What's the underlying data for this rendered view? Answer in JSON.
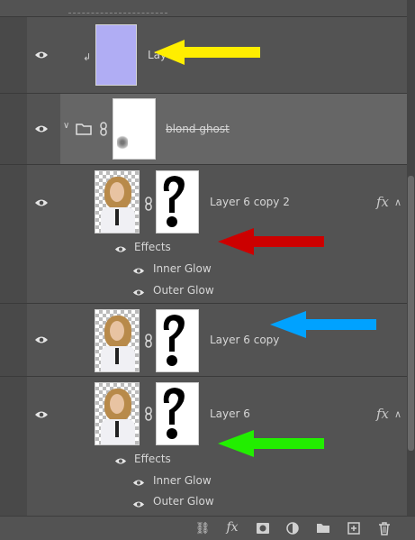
{
  "layers": [
    {
      "name": "Layer 7",
      "type": "fill-clipped"
    },
    {
      "name": "blond ghost",
      "type": "group"
    },
    {
      "name": "Layer 6 copy 2",
      "fx": "fx",
      "effects_label": "Effects",
      "effects": [
        "Inner Glow",
        "Outer Glow"
      ]
    },
    {
      "name": "Layer 6 copy"
    },
    {
      "name": "Layer 6",
      "fx": "fx",
      "effects_label": "Effects",
      "effects": [
        "Inner Glow",
        "Outer Glow"
      ]
    }
  ],
  "colors": {
    "panel_bg": "#535353",
    "group_bg": "#666666",
    "layer7_fill": "#b0adf4",
    "arrow_yellow": "#ffee00",
    "arrow_red": "#cc0000",
    "arrow_blue": "#00a2ff",
    "arrow_green": "#22ee00"
  },
  "bottom_icons": [
    "link-icon",
    "fx-icon",
    "mask-icon",
    "adjustment-icon",
    "folder-icon",
    "new-layer-icon",
    "trash-icon"
  ],
  "bottom_fx_label": "fx"
}
